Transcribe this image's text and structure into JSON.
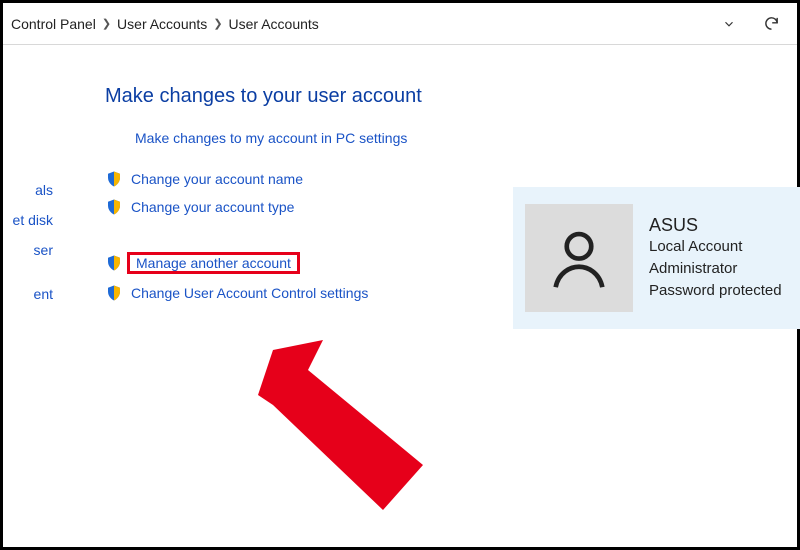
{
  "breadcrumbs": {
    "a": "Control Panel",
    "b": "User Accounts",
    "c": "User Accounts"
  },
  "side": {
    "a": "als",
    "b": "et disk",
    "c": "ser",
    "d": "ent"
  },
  "heading": "Make changes to your user account",
  "links": {
    "pc_settings": "Make changes to my account in PC settings",
    "change_name": "Change your account name",
    "change_type": "Change your account type",
    "manage_other": "Manage another account",
    "uac": "Change User Account Control settings"
  },
  "account": {
    "name": "ASUS",
    "type": "Local Account",
    "role": "Administrator",
    "pwd": "Password protected"
  }
}
